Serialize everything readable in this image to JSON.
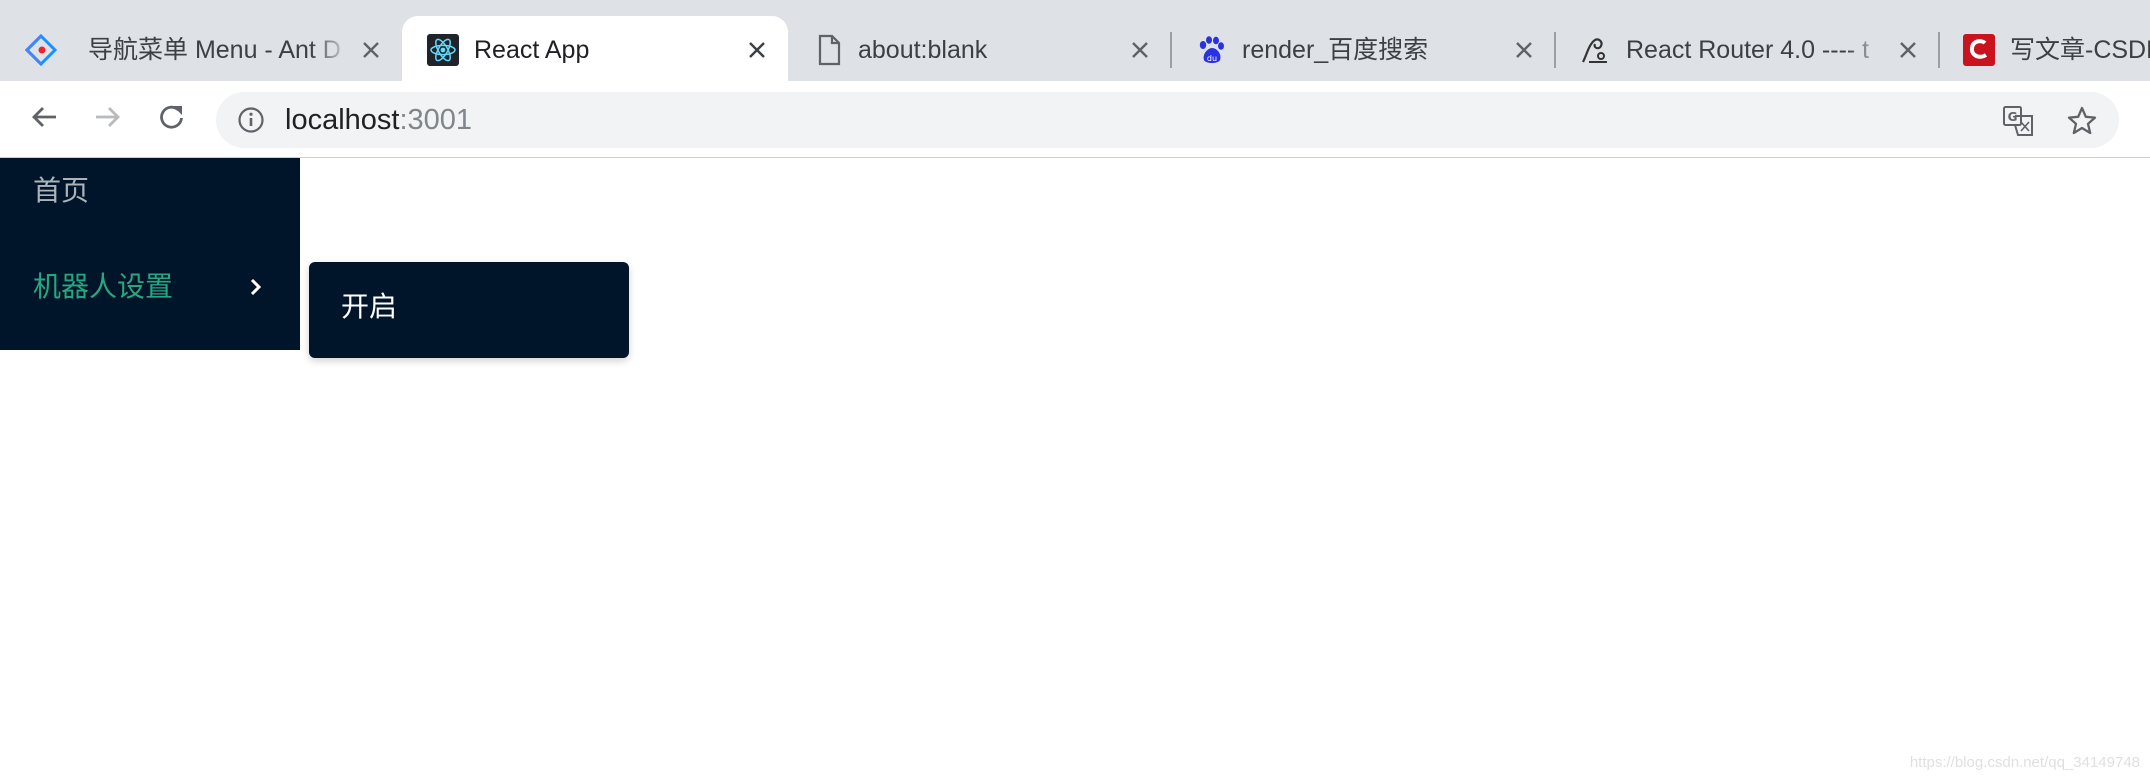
{
  "browser": {
    "tabs": [
      {
        "title": "导航菜单 Menu - Ant D",
        "favicon": "ant-design-icon",
        "active": false
      },
      {
        "title": "React App",
        "favicon": "react-icon",
        "active": true
      },
      {
        "title": "about:blank",
        "favicon": "blank-page-icon",
        "active": false
      },
      {
        "title": "render_百度搜索",
        "favicon": "baidu-paw-icon",
        "active": false
      },
      {
        "title": "React Router 4.0 ---- t",
        "favicon": "router-icon",
        "active": false
      },
      {
        "title": "写文章-CSDN",
        "favicon": "csdn-icon",
        "active": false
      }
    ],
    "address": {
      "host": "localhost",
      "port": ":3001"
    },
    "accent_colors": {
      "tabstrip": "#dee1e6",
      "omnibox": "#f1f3f4"
    }
  },
  "sider_menu": {
    "items": [
      {
        "label": "首页"
      },
      {
        "label": "机器人设置",
        "expanded": true
      }
    ],
    "submenu": {
      "items": [
        {
          "label": "开启"
        }
      ]
    },
    "colors": {
      "background": "#001529",
      "selected_text": "#26a781"
    }
  },
  "watermark": "https://blog.csdn.net/qq_34149748"
}
